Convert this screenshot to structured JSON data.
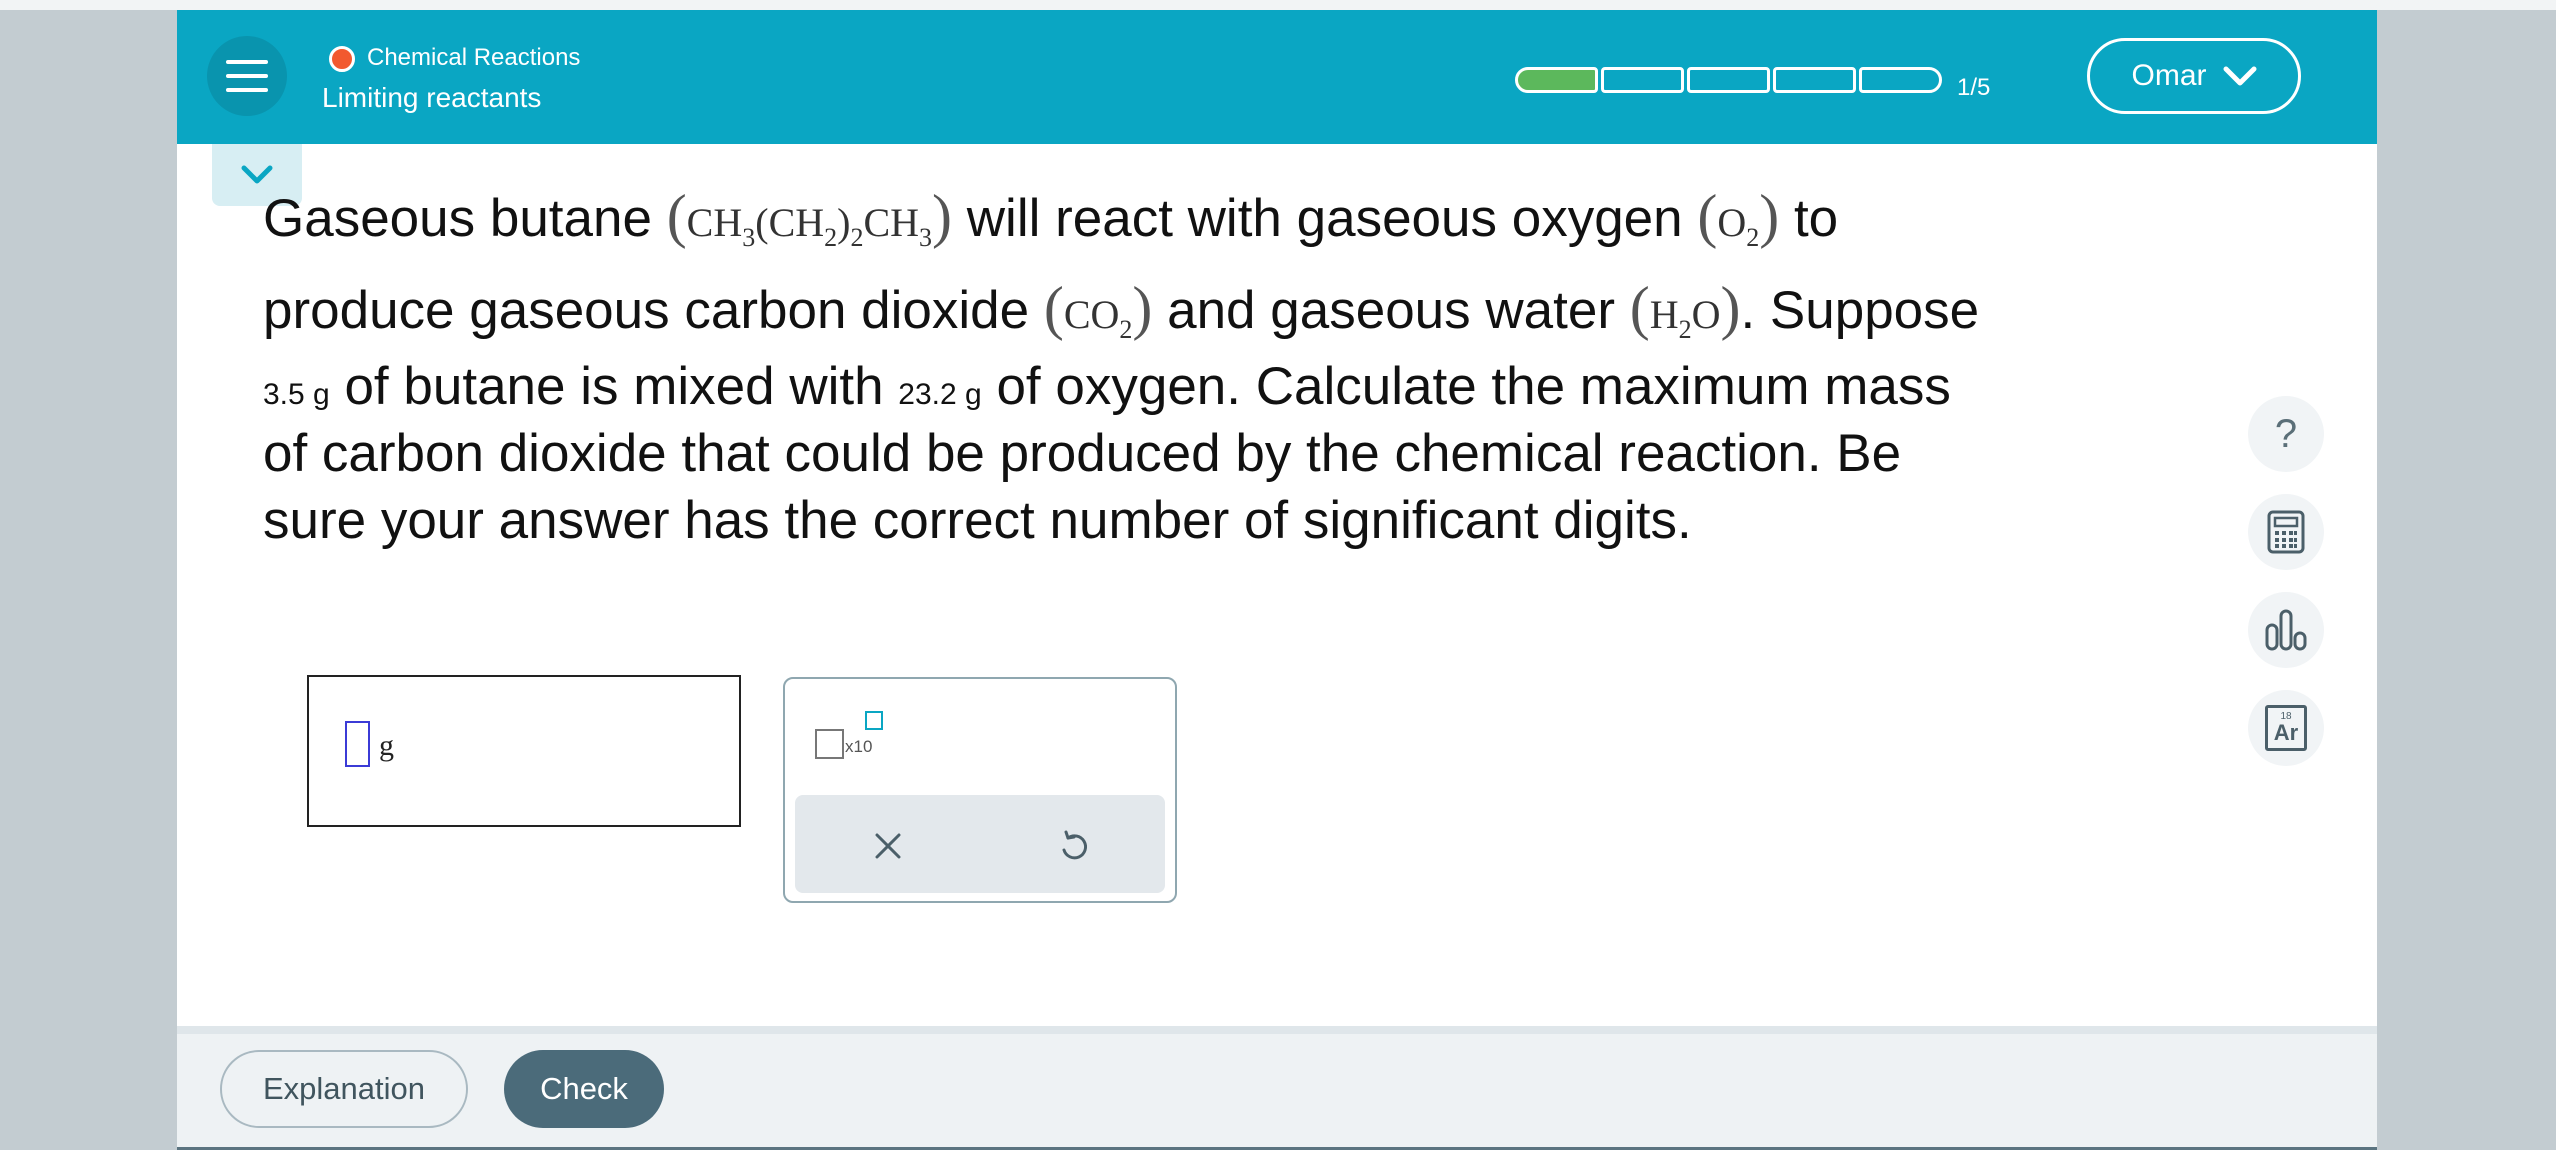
{
  "header": {
    "topic": "Chemical Reactions",
    "subtopic": "Limiting reactants",
    "progress": {
      "label": "1/5",
      "completed": 1,
      "total": 5
    },
    "user_name": "Omar"
  },
  "question": {
    "l1_a": "Gaseous butane ",
    "butane_formula": {
      "ch3_a": "CH",
      "s1": "3",
      "ch2": "(CH",
      "s2": "2",
      "s3": "2",
      "ch3_b": "CH",
      "s4": "3"
    },
    "l1_b": " will react with gaseous oxygen ",
    "oxygen_formula": {
      "o": "O",
      "s": "2"
    },
    "l1_c": " to",
    "l2_a": "produce gaseous carbon dioxide ",
    "co2_formula": {
      "co": "CO",
      "s": "2"
    },
    "l2_b": " and gaseous water ",
    "water_formula": {
      "h": "H",
      "s": "2",
      "o": "O"
    },
    "l2_c": ". Suppose",
    "mass_butane": "3.5 g",
    "l3_a": " of butane is mixed with ",
    "mass_oxygen": "23.2 g",
    "l3_b": " of oxygen. Calculate the maximum mass",
    "l4": "of carbon dioxide that could be produced by the chemical reaction. Be",
    "l5": "sure your answer has the correct number of significant digits."
  },
  "answer": {
    "value": "",
    "unit": "g"
  },
  "keypad": {
    "x10_label": "x10"
  },
  "tools": [
    "help-icon",
    "calculator-icon",
    "chart-icon",
    "periodic-table-icon"
  ],
  "periodic_icon": {
    "number": "18",
    "symbol": "Ar"
  },
  "help_glyph": "?",
  "footer": {
    "explanation_label": "Explanation",
    "check_label": "Check"
  },
  "colors": {
    "header": "#0aa6c3",
    "progress_fill": "#5cb85c",
    "check_button": "#4b6b7a",
    "topic_dot": "#f2592f"
  }
}
